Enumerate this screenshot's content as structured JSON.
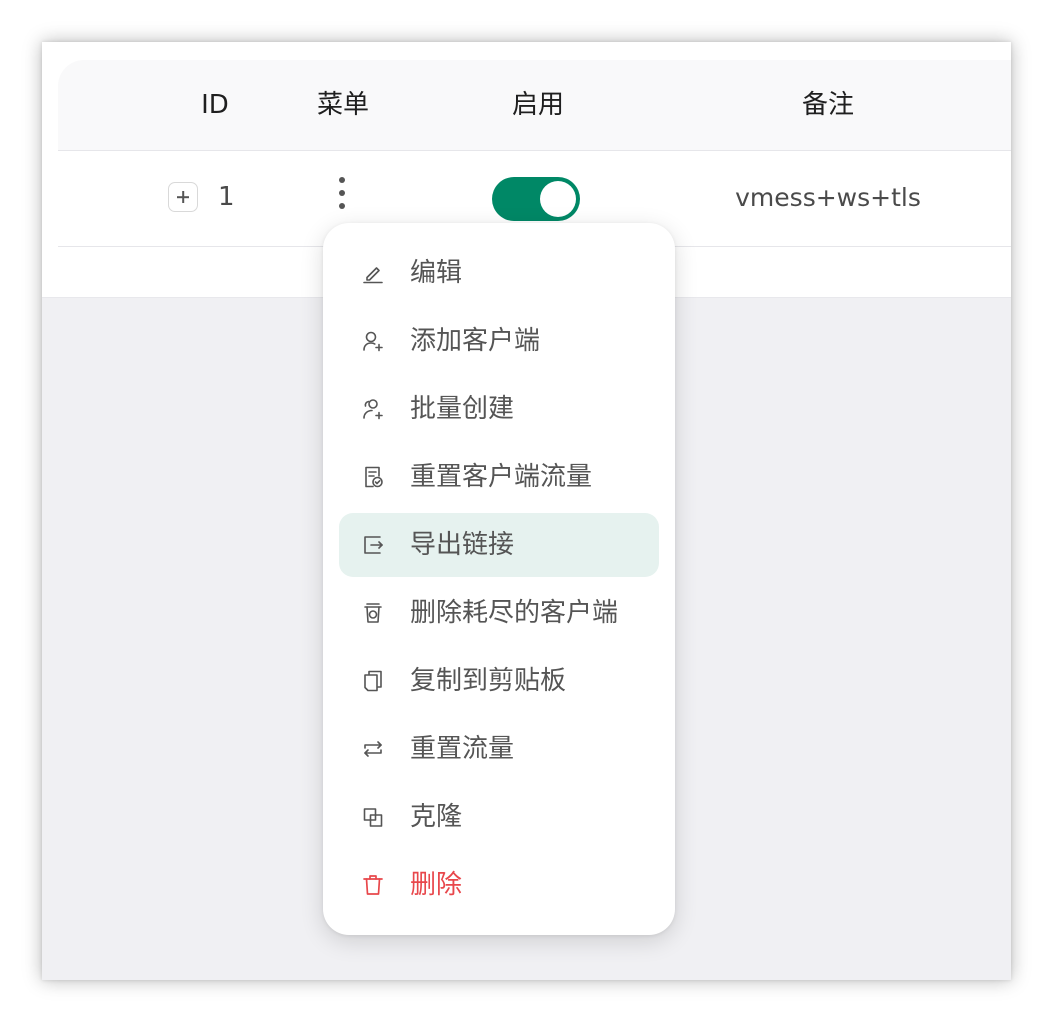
{
  "table": {
    "columns": {
      "id": "ID",
      "menu": "菜单",
      "enabled": "启用",
      "remark": "备注"
    },
    "rows": [
      {
        "id": "1",
        "enabled": true,
        "remark": "vmess+ws+tls"
      }
    ]
  },
  "menu": {
    "items": [
      {
        "label": "编辑",
        "icon": "edit-icon"
      },
      {
        "label": "添加客户端",
        "icon": "user-add-icon"
      },
      {
        "label": "批量创建",
        "icon": "users-add-icon"
      },
      {
        "label": "重置客户端流量",
        "icon": "file-check-icon"
      },
      {
        "label": "导出链接",
        "icon": "export-icon",
        "active": true
      },
      {
        "label": "删除耗尽的客户端",
        "icon": "rest-icon"
      },
      {
        "label": "复制到剪贴板",
        "icon": "copy-icon"
      },
      {
        "label": "重置流量",
        "icon": "swap-icon"
      },
      {
        "label": "克隆",
        "icon": "block-icon"
      },
      {
        "label": "删除",
        "icon": "delete-icon",
        "danger": true
      }
    ]
  },
  "colors": {
    "accent": "#008866",
    "active_bg": "#e6f2ef",
    "danger": "#e8474b"
  }
}
